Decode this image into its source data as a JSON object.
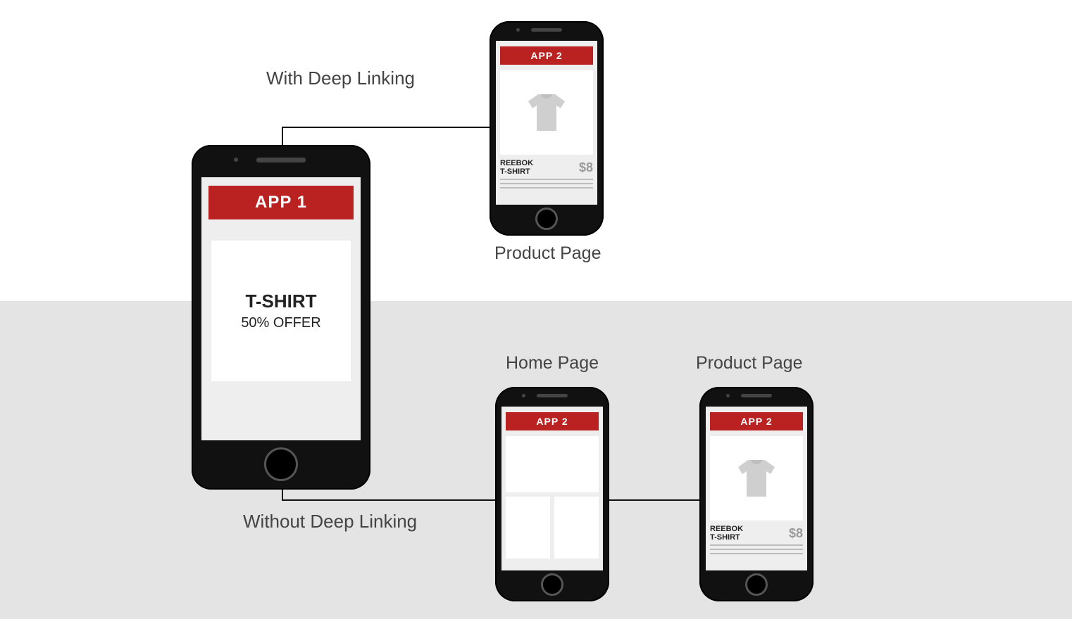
{
  "labels": {
    "with": "With Deep Linking",
    "without": "Without Deep Linking",
    "product": "Product Page",
    "home": "Home Page"
  },
  "phone_source": {
    "app_label": "APP 1",
    "promo_line1": "T-SHIRT",
    "promo_line2": "50% OFFER"
  },
  "phone_deep": {
    "app_label": "APP 2",
    "product_name": "REEBOK\nT-SHIRT",
    "product_price": "$8"
  },
  "phone_home": {
    "app_label": "APP 2"
  },
  "phone_nodeep_product": {
    "app_label": "APP 2",
    "product_name": "REEBOK\nT-SHIRT",
    "product_price": "$8"
  },
  "colors": {
    "accent": "#ba2222",
    "band": "#e4e4e4"
  }
}
